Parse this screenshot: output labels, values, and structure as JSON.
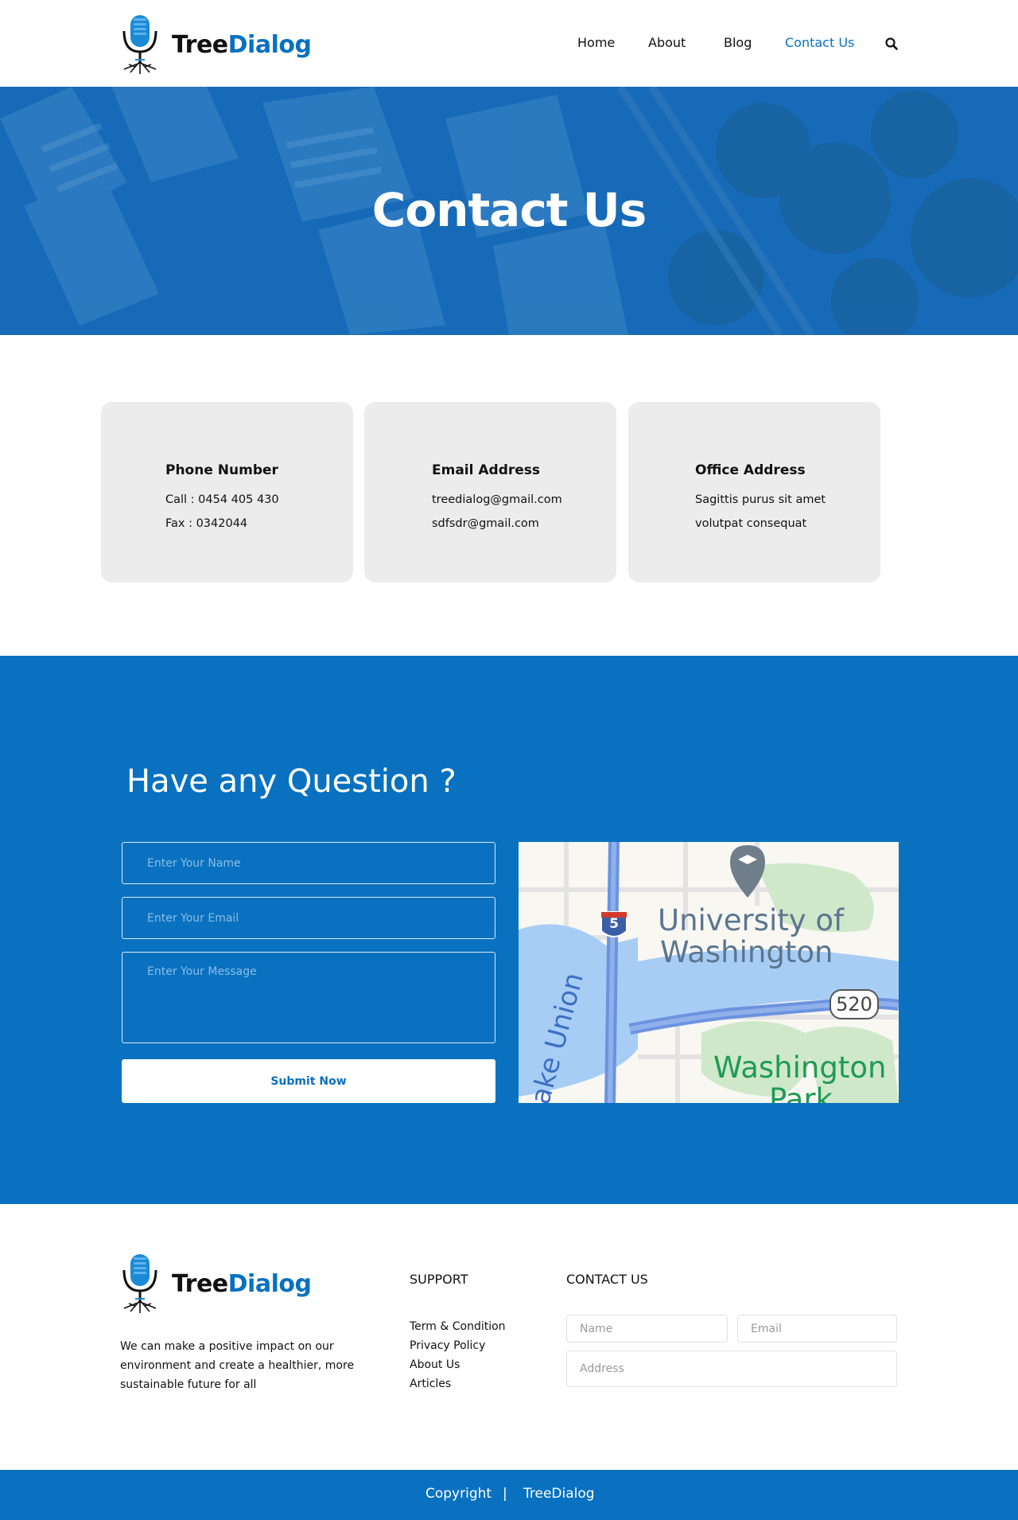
{
  "brand": {
    "name_part1": "Tree",
    "name_part2": "Dialog",
    "primary_color": "#0971c0"
  },
  "nav": {
    "items": [
      {
        "label": "Home"
      },
      {
        "label": "About"
      },
      {
        "label": "Blog"
      },
      {
        "label": "Contact Us",
        "active": true
      }
    ],
    "search_icon": "search-icon"
  },
  "hero": {
    "title": "Contact Us"
  },
  "info_cards": [
    {
      "title": "Phone Number",
      "line1": "Call : 0454 405 430",
      "line2": "Fax : 0342044"
    },
    {
      "title": "Email Address",
      "line1": "treedialog@gmail.com",
      "line2": "sdfsdr@gmail.com"
    },
    {
      "title": "Office Address",
      "line1": "Sagittis purus sit amet",
      "line2": "volutpat consequat"
    }
  ],
  "question_form": {
    "title": "Have any Question ?",
    "name_placeholder": "Enter Your Name",
    "email_placeholder": "Enter Your Email",
    "message_placeholder": "Enter Your Message",
    "submit_label": "Submit Now"
  },
  "map": {
    "labels": [
      "University of",
      "Washington",
      "Washington",
      "Park",
      "ake Union"
    ],
    "highway_5": "5",
    "highway_520": "520"
  },
  "footer": {
    "description": "We can make a positive impact on our environment and create a healthier, more sustainable future for all",
    "support_heading": "SUPPORT",
    "support_links": [
      "Term & Condition",
      "Privacy Policy",
      "About Us",
      "Articles"
    ],
    "contact_heading": "CONTACT US",
    "contact_form": {
      "name_placeholder": "Name",
      "email_placeholder": "Email",
      "address_placeholder": "Address"
    }
  },
  "bottom_bar": {
    "copyright": "Copyright",
    "separator": "|",
    "brand": "TreeDialog"
  }
}
